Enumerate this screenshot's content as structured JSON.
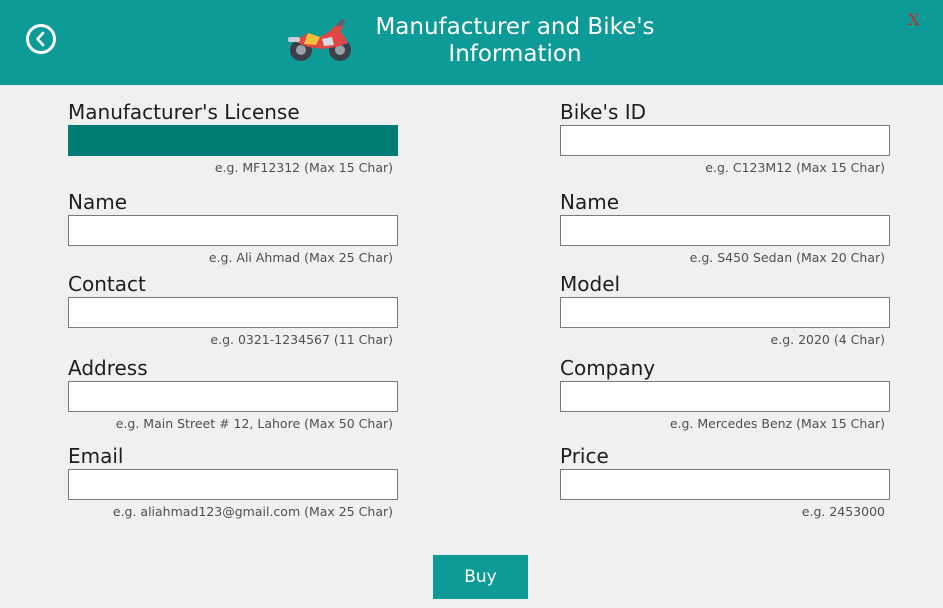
{
  "header": {
    "title_line1": "Manufacturer and Bike's",
    "title_line2": "Information",
    "close_label": "X",
    "back_icon": "circle-chevron-left-icon",
    "logo_icon": "motorbike-logo-icon",
    "accent_color": "#0e9a96"
  },
  "manufacturer": {
    "license": {
      "label": "Manufacturer's License",
      "value": "",
      "hint": "e.g. MF12312 (Max 15 Char)"
    },
    "name": {
      "label": "Name",
      "value": "",
      "hint": "e.g. Ali Ahmad (Max 25 Char)"
    },
    "contact": {
      "label": "Contact",
      "value": "",
      "hint": "e.g. 0321-1234567 (11 Char)"
    },
    "address": {
      "label": "Address",
      "value": "",
      "hint": "e.g. Main Street # 12, Lahore (Max 50 Char)"
    },
    "email": {
      "label": "Email",
      "value": "",
      "hint": "e.g. aliahmad123@gmail.com (Max 25 Char)"
    }
  },
  "bike": {
    "id": {
      "label": "Bike's ID",
      "value": "",
      "hint": "e.g. C123M12 (Max 15 Char)"
    },
    "name": {
      "label": "Name",
      "value": "",
      "hint": "e.g. S450 Sedan (Max 20 Char)"
    },
    "model": {
      "label": "Model",
      "value": "",
      "hint": "e.g. 2020 (4 Char)"
    },
    "company": {
      "label": "Company",
      "value": "",
      "hint": "e.g. Mercedes Benz (Max 15 Char)"
    },
    "price": {
      "label": "Price",
      "value": "",
      "hint": "e.g. 2453000"
    }
  },
  "actions": {
    "buy_label": "Buy"
  }
}
